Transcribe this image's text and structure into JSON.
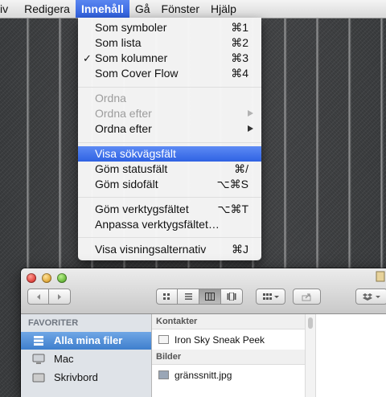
{
  "menubar": {
    "items": [
      {
        "label": "iv"
      },
      {
        "label": "Redigera"
      },
      {
        "label": "Innehåll"
      },
      {
        "label": "Gå"
      },
      {
        "label": "Fönster"
      },
      {
        "label": "Hjälp"
      }
    ]
  },
  "menu": {
    "checkmark": "✓",
    "items": [
      {
        "label": "Som symboler",
        "shortcut": "⌘1"
      },
      {
        "label": "Som lista",
        "shortcut": "⌘2"
      },
      {
        "label": "Som kolumner",
        "shortcut": "⌘3",
        "checked": true
      },
      {
        "label": "Som Cover Flow",
        "shortcut": "⌘4"
      },
      {
        "label": "Ordna",
        "disabled": true
      },
      {
        "label": "Ordna efter",
        "disabled": true,
        "submenu": true
      },
      {
        "label": "Ordna efter",
        "submenu": true
      },
      {
        "label": "Visa sökvägsfält",
        "highlighted": true
      },
      {
        "label": "Göm statusfält",
        "shortcut": "⌘/"
      },
      {
        "label": "Göm sidofält",
        "shortcut": "⌥⌘S"
      },
      {
        "label": "Göm verktygsfältet",
        "shortcut": "⌥⌘T"
      },
      {
        "label": "Anpassa verktygsfältet…"
      },
      {
        "label": "Visa visningsalternativ",
        "shortcut": "⌘J"
      }
    ]
  },
  "finder": {
    "sidebar": {
      "heading": "FAVORITER",
      "items": [
        {
          "label": "Alla mina filer",
          "selected": true
        },
        {
          "label": "Mac"
        },
        {
          "label": "Skrivbord"
        }
      ]
    },
    "groups": [
      {
        "heading": "Kontakter",
        "rows": [
          {
            "label": "Iron Sky Sneak Peek"
          }
        ]
      },
      {
        "heading": "Bilder",
        "rows": [
          {
            "label": "gränssnitt.jpg"
          }
        ]
      }
    ]
  },
  "colors": {
    "menu_highlight": "#3464e6",
    "sidebar_selection": "#4f8bd6",
    "disabled_text": "#9c9c9c"
  }
}
